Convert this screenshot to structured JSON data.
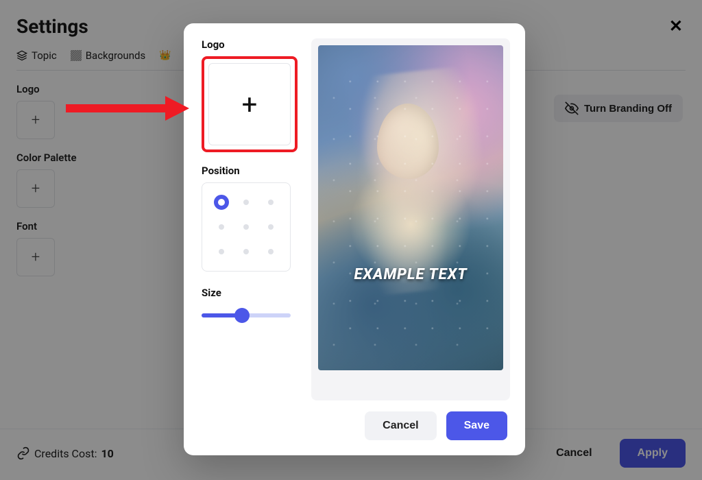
{
  "page": {
    "title": "Settings",
    "tabs": [
      {
        "label": "Topic"
      },
      {
        "label": "Backgrounds"
      }
    ],
    "sections": {
      "logo": "Logo",
      "palette": "Color Palette",
      "font": "Font"
    },
    "branding_btn": "Turn Branding Off",
    "credits_label": "Credits Cost:",
    "credits_value": "10",
    "footer": {
      "cancel": "Cancel",
      "apply": "Apply"
    }
  },
  "modal": {
    "logo_label": "Logo",
    "position_label": "Position",
    "size_label": "Size",
    "position_selected": 0,
    "size_percent": 45,
    "preview_text": "EXAMPLE TEXT",
    "cancel": "Cancel",
    "save": "Save"
  }
}
